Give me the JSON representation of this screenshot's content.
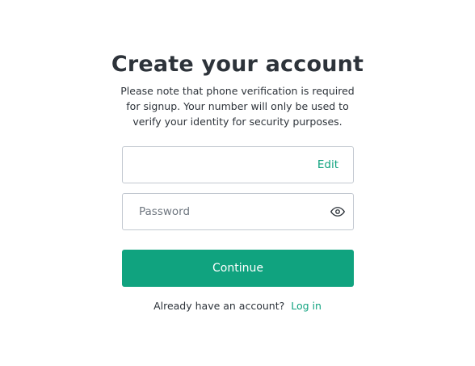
{
  "heading": {
    "title": "Create your account",
    "subtitle": "Please note that phone verification is required for signup. Your number will only be used to verify your identity for security purposes."
  },
  "form": {
    "email": {
      "value": "",
      "edit_label": "Edit"
    },
    "password": {
      "value": "",
      "placeholder": "Password",
      "toggle_icon": "eye-icon"
    },
    "continue_label": "Continue"
  },
  "footer": {
    "prompt": "Already have an account?",
    "login_label": "Log in"
  },
  "colors": {
    "accent": "#10a37f",
    "text": "#2d333a",
    "border": "#c2c8d0"
  }
}
